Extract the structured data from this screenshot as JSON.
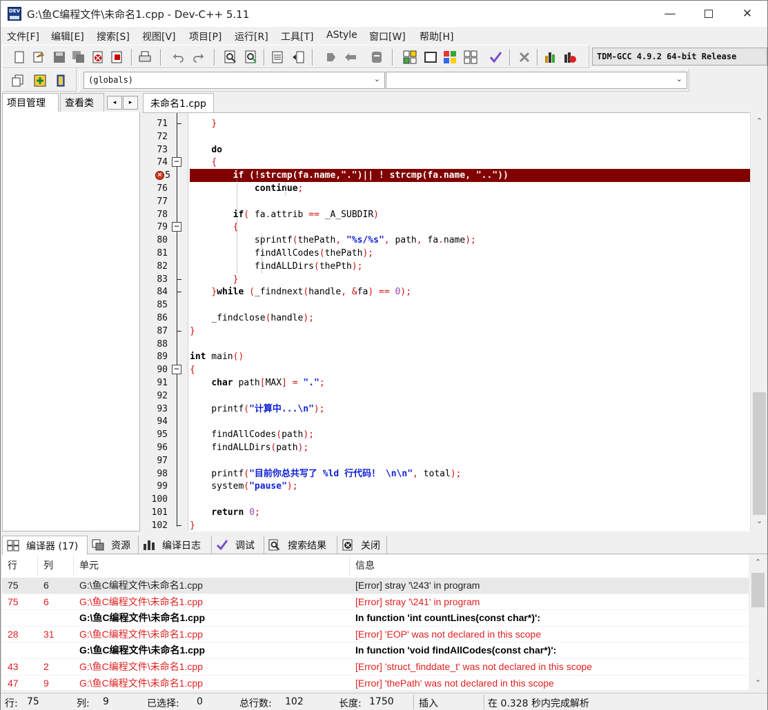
{
  "window": {
    "title": "G:\\鱼C编程文件\\未命名1.cpp - Dev-C++ 5.11",
    "icon_text": "DEV",
    "controls": [
      "minimize-icon",
      "maximize-icon",
      "close-icon"
    ]
  },
  "menu": [
    "文件[F]",
    "编辑[E]",
    "搜索[S]",
    "视图[V]",
    "项目[P]",
    "运行[R]",
    "工具[T]",
    "AStyle",
    "窗口[W]",
    "帮助[H]"
  ],
  "toolbar": {
    "compiler_select": "TDM-GCC 4.9.2 64-bit Release",
    "scope_combo": "(globals)",
    "member_combo": ""
  },
  "left_panel": {
    "tabs": [
      "项目管理",
      "查看类"
    ],
    "nav": [
      "◂",
      "▸"
    ]
  },
  "editor": {
    "tab": "未命名1.cpp",
    "error_line": 75,
    "lines": [
      {
        "n": "71",
        "text": "    }"
      },
      {
        "n": "72",
        "text": ""
      },
      {
        "n": "73",
        "text": "    do"
      },
      {
        "n": "74",
        "text": "    {"
      },
      {
        "n": "75",
        "text": "        if (!strcmp(fa.name,\".\")|| ! strcmp(fa.name, \"..\"))"
      },
      {
        "n": "76",
        "text": "            continue;"
      },
      {
        "n": "77",
        "text": ""
      },
      {
        "n": "78",
        "text": "        if( fa.attrib == _A_SUBDIR)"
      },
      {
        "n": "79",
        "text": "        {"
      },
      {
        "n": "80",
        "text": "            sprintf(thePath, \"%s/%s\", path, fa.name);"
      },
      {
        "n": "81",
        "text": "            findAllCodes(thePath);"
      },
      {
        "n": "82",
        "text": "            findALLDirs(thePth);"
      },
      {
        "n": "83",
        "text": "        }"
      },
      {
        "n": "84",
        "text": "    }while (_findnext(handle, &fa) == 0);"
      },
      {
        "n": "85",
        "text": ""
      },
      {
        "n": "86",
        "text": "    _findclose(handle);"
      },
      {
        "n": "87",
        "text": "}"
      },
      {
        "n": "88",
        "text": ""
      },
      {
        "n": "89",
        "text": "int main()"
      },
      {
        "n": "90",
        "text": "{"
      },
      {
        "n": "91",
        "text": "    char path[MAX] = \".\";"
      },
      {
        "n": "92",
        "text": ""
      },
      {
        "n": "93",
        "text": "    printf(\"计算中...\\n\");"
      },
      {
        "n": "94",
        "text": ""
      },
      {
        "n": "95",
        "text": "    findAllCodes(path);"
      },
      {
        "n": "96",
        "text": "    findALLDirs(path);"
      },
      {
        "n": "97",
        "text": ""
      },
      {
        "n": "98",
        "text": "    printf(\"目前你总共写了 %ld 行代码！ \\n\\n\", total);"
      },
      {
        "n": "99",
        "text": "    system(\"pause\");"
      },
      {
        "n": "100",
        "text": ""
      },
      {
        "n": "101",
        "text": "    return 0;"
      },
      {
        "n": "102",
        "text": "}"
      }
    ]
  },
  "bottom_tabs": [
    "编译器 (17)",
    "资源",
    "编译日志",
    "调试",
    "搜索结果",
    "关闭"
  ],
  "messages": {
    "headers": [
      "行",
      "列",
      "单元",
      "信息"
    ],
    "rows": [
      {
        "line": "75",
        "col": "6",
        "unit": "G:\\鱼C编程文件\\未命名1.cpp",
        "msg": "[Error] stray '\\243' in program",
        "style": "sel"
      },
      {
        "line": "75",
        "col": "6",
        "unit": "G:\\鱼C编程文件\\未命名1.cpp",
        "msg": "[Error] stray '\\241' in program",
        "style": "red"
      },
      {
        "line": "",
        "col": "",
        "unit": "G:\\鱼C编程文件\\未命名1.cpp",
        "msg": "In function 'int countLines(const char*)':",
        "style": "bold"
      },
      {
        "line": "28",
        "col": "31",
        "unit": "G:\\鱼C编程文件\\未命名1.cpp",
        "msg": "[Error] 'EOP' was not declared in this scope",
        "style": "red"
      },
      {
        "line": "",
        "col": "",
        "unit": "G:\\鱼C编程文件\\未命名1.cpp",
        "msg": "In function 'void findAllCodes(const char*)':",
        "style": "bold"
      },
      {
        "line": "43",
        "col": "2",
        "unit": "G:\\鱼C编程文件\\未命名1.cpp",
        "msg": "[Error] 'struct_finddate_t' was not declared in this scope",
        "style": "red"
      },
      {
        "line": "47",
        "col": "9",
        "unit": "G:\\鱼C编程文件\\未命名1.cpp",
        "msg": "[Error] 'thePath' was not declared in this scope",
        "style": "red"
      }
    ]
  },
  "status": {
    "row_label": "行:",
    "row": "75",
    "col_label": "列:",
    "col": "9",
    "sel_label": "已选择:",
    "sel": "0",
    "total_label": "总行数:",
    "total": "102",
    "len_label": "长度:",
    "len": "1750",
    "mode": "插入",
    "parse": "在 0.328 秒内完成解析"
  },
  "colors": {
    "error_line_bg": "#800000",
    "error_text": "#e02020",
    "keyword_string": "#1020d8",
    "symbol": "#d01010"
  }
}
